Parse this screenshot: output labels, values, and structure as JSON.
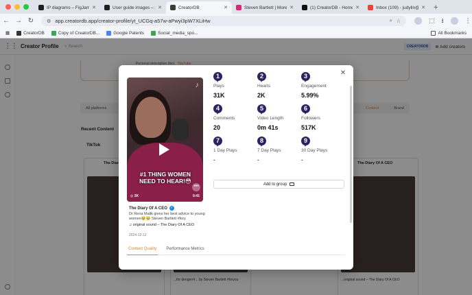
{
  "browser": {
    "tabs": [
      {
        "title": "IP diagrams – FigJam",
        "color": "#1f1f1f"
      },
      {
        "title": "User guide images – Figma",
        "color": "#1f1f1f"
      },
      {
        "title": "CreatorDB",
        "color": "#3b3b3b",
        "active": true
      },
      {
        "title": "Steven Bartlett | More th...",
        "color": "#d62976"
      },
      {
        "title": "(1) CreatorDB - Home",
        "color": "#111111"
      },
      {
        "title": "Inbox (109) - judylin@cre...",
        "color": "#ea4335"
      }
    ],
    "url": "app.creatordb.app/creator-profile/yt_UCGq-a57w-aPwyi3pW7XLiHw",
    "bookmarks": [
      "CreatorDB",
      "Copy of CreatorDB...",
      "Google Patents",
      "Social_media_spo..."
    ],
    "all_bookmarks": "All Bookmarks"
  },
  "app": {
    "title": "Creator Profile",
    "search_placeholder": "Search",
    "badge": "CREATORDB",
    "add_creators": "Add creators",
    "personal_description": "Personal description (bio)",
    "personal_description_link": "YouTube",
    "platform_all": "All platforms",
    "platform_content": "Content",
    "platform_brand": "Brand",
    "recent_content": "Recent Content",
    "tiktok": "TikTok",
    "bg_cards": [
      {
        "channel": "The Diary Of A CEO",
        "caption": "",
        "date": ""
      },
      {
        "channel": "",
        "caption": "...for dengerr#... by Steven Bartlett #foryou",
        "date": ""
      },
      {
        "channel": "The Diary Of A CEO",
        "caption": "...original sound – The Diary Of A CEO",
        "date": "2024-12-11"
      }
    ]
  },
  "modal": {
    "video": {
      "overlay_text": "#1 THING WOMEN NEED TO HEAR!😳",
      "views": "2K",
      "duration": "0:41"
    },
    "channel": "The Diary Of A CEO",
    "description": "Dr Rena Malik gives her best advice to young women🥹🥹 Steven Bartlett #fory",
    "sound": "original sound – The Diary Of A CEO",
    "date": "2024-12-12",
    "metrics": [
      {
        "num": "1",
        "label": "Plays",
        "value": "31K"
      },
      {
        "num": "2",
        "label": "Hearts",
        "value": "2K"
      },
      {
        "num": "3",
        "label": "Engagement",
        "value": "5.99%"
      },
      {
        "num": "4",
        "label": "Comments",
        "value": "20"
      },
      {
        "num": "5",
        "label": "Video Length",
        "value": "0m 41s"
      },
      {
        "num": "6",
        "label": "Followers",
        "value": "517K"
      },
      {
        "num": "7",
        "label": "1 Day Plays",
        "value": "-"
      },
      {
        "num": "8",
        "label": "7 Day Plays",
        "value": "-"
      },
      {
        "num": "9",
        "label": "30 Day Plays",
        "value": "-"
      }
    ],
    "add_to_group": "Add to group",
    "tabs": [
      "Content Quality",
      "Performance Metrics"
    ],
    "accent": "#e0803b",
    "pin_color": "#2a2462"
  }
}
